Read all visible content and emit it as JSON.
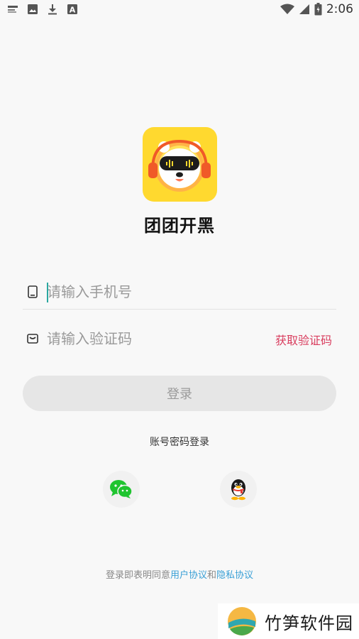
{
  "status_bar": {
    "time": "2:06",
    "left_icons": [
      "notification-icon",
      "image-icon",
      "download-icon",
      "a-icon"
    ],
    "right_icons": [
      "wifi-icon",
      "signal-icon",
      "battery-icon"
    ]
  },
  "app": {
    "name": "团团开黑",
    "logo": "panda-headphones-logo",
    "accent": "#ffd92f"
  },
  "phone_field": {
    "icon": "phone-icon",
    "placeholder": "请输入手机号",
    "value": ""
  },
  "code_field": {
    "icon": "message-icon",
    "placeholder": "请输入验证码",
    "value": "",
    "get_code_label": "获取验证码",
    "get_code_color": "#d93d5e"
  },
  "login_button": {
    "label": "登录"
  },
  "account_login_label": "账号密码登录",
  "social": [
    {
      "name": "wechat",
      "icon": "wechat-icon"
    },
    {
      "name": "qq",
      "icon": "qq-icon"
    }
  ],
  "agreement": {
    "prefix": "登录即表明同意",
    "user_agreement": "用户协议",
    "and": "和",
    "privacy_agreement": "隐私协议",
    "link_color": "#3aa0d6"
  },
  "watermark": {
    "text": "竹笋软件园"
  }
}
